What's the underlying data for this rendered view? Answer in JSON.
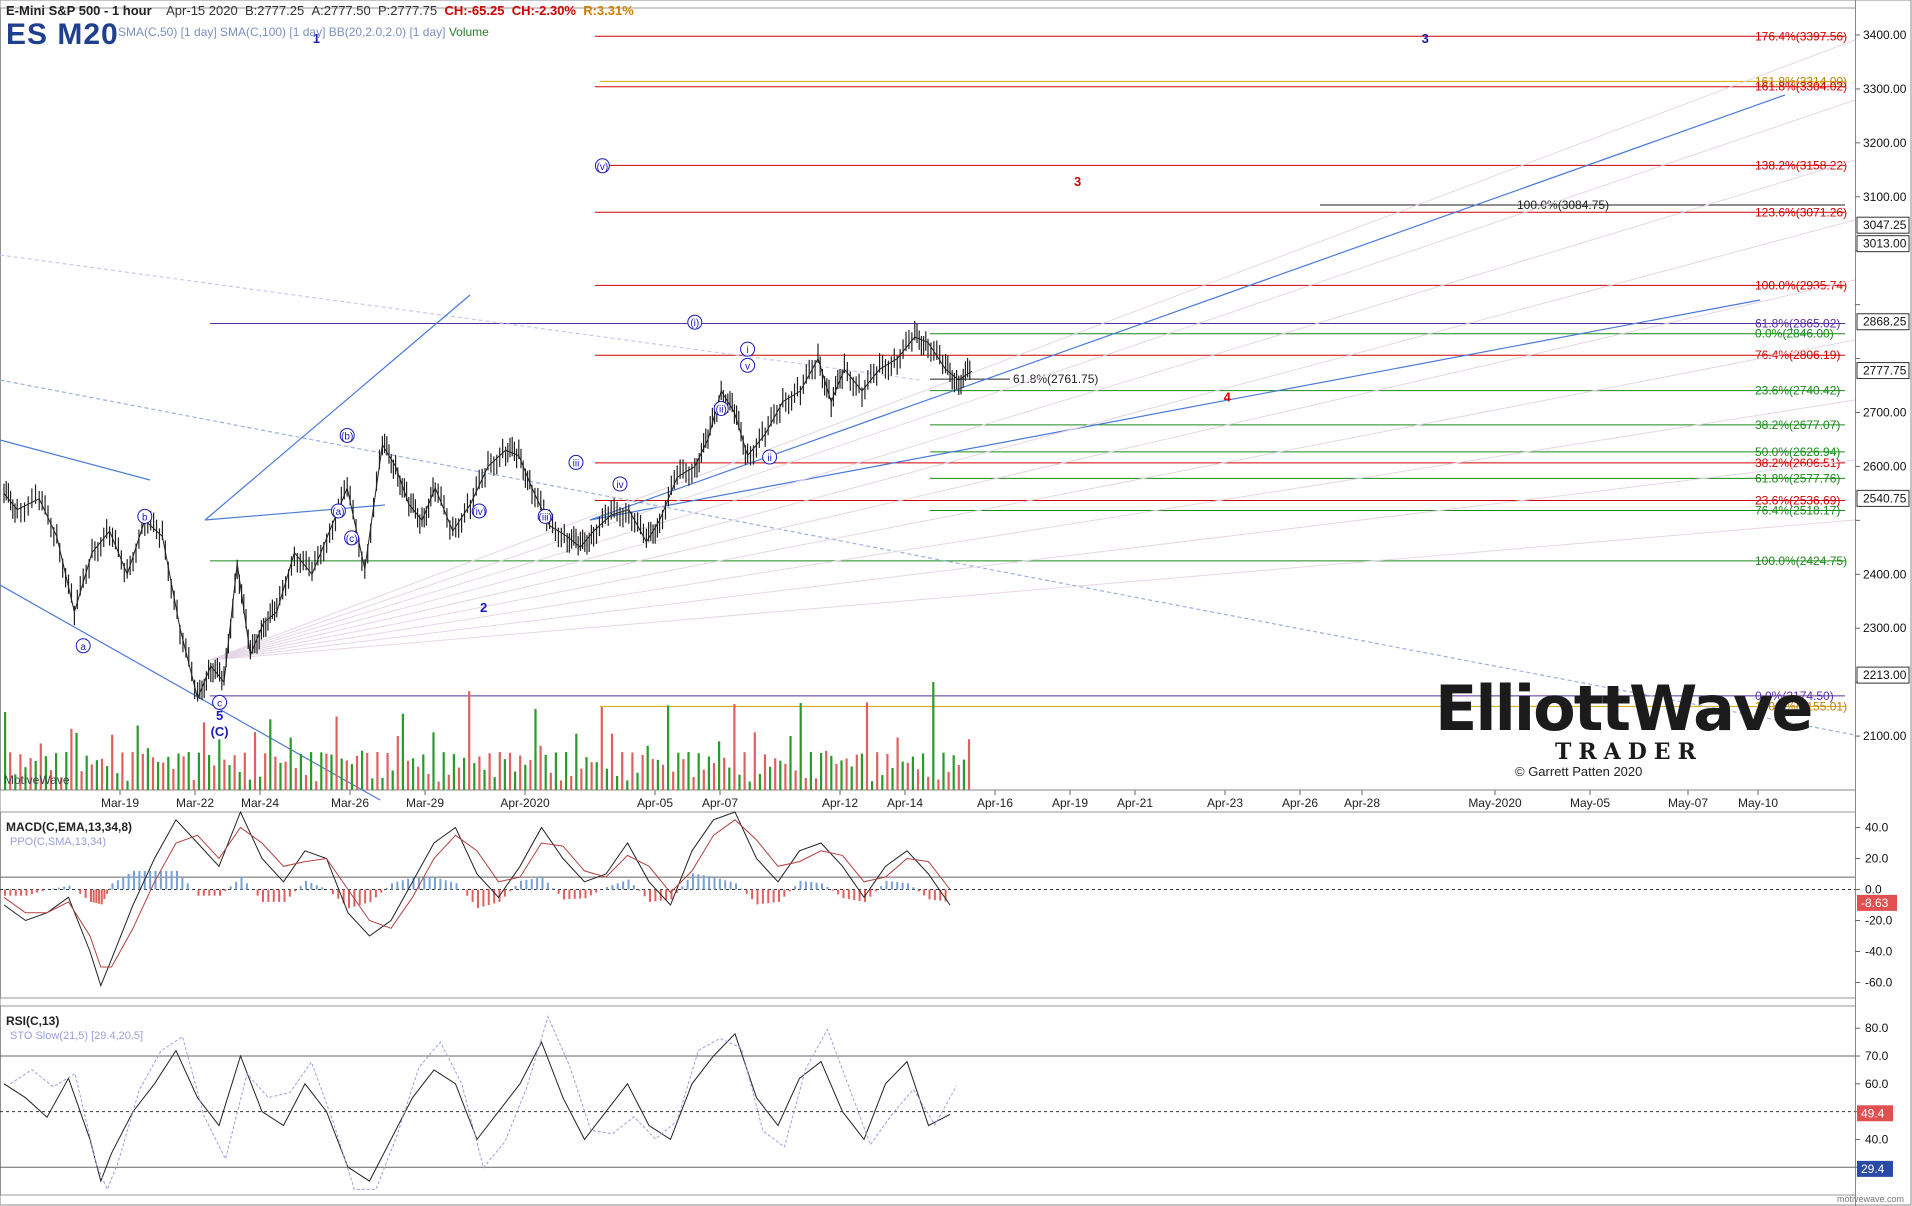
{
  "header": {
    "title": "E-Mini S&P 500 - 1 hour",
    "date": "Apr-15 2020",
    "bid": "B:2777.25",
    "ask": "A:2777.50",
    "price": "P:2777.75",
    "change": "CH:-65.25",
    "change_pct": "CH:-2.30%",
    "range": "R:3.31%",
    "ticker": "ES M20",
    "indicators": "SMA(C,50) [1 day] SMA(C,100) [1 day] BB(20,2.0,2.0) [1 day]",
    "volume_label": "Volume"
  },
  "watermark": "MotiveWave",
  "footer": "motivewave.com",
  "logo": {
    "line1": "ElliottWave",
    "line2": "TRADER",
    "copyright": "© Garrett Patten 2020"
  },
  "colors": {
    "red": "#d00000",
    "blue": "#1a1ab8",
    "green": "#1a8a1a",
    "purple": "#5a2ea0",
    "gold": "#d9a400",
    "up_bar": "#2a9a2a",
    "down_bar": "#e06060"
  },
  "chart_data": [
    {
      "type": "line",
      "name_text": "E-Mini S&P 500 - 1 hour",
      "ylim": [
        2000,
        3450
      ],
      "y_ticks": [
        2100,
        2200,
        2300,
        2400,
        2500,
        2600,
        2700,
        2800,
        2900,
        3000,
        3100,
        3200,
        3300,
        3400
      ],
      "x_ticks": [
        "Mar-19",
        "Mar-22",
        "Mar-24",
        "Mar-26",
        "Mar-29",
        "Apr-2020",
        "Apr-05",
        "Apr-07",
        "Apr-12",
        "Apr-14",
        "Apr-16",
        "Apr-19",
        "Apr-21",
        "Apr-23",
        "Apr-26",
        "Apr-28",
        "May-2020",
        "May-05",
        "May-07",
        "May-10"
      ],
      "price_path": [
        [
          0,
          2550
        ],
        [
          0.3,
          2520
        ],
        [
          0.8,
          2540
        ],
        [
          1.2,
          2470
        ],
        [
          1.6,
          2330
        ],
        [
          2.0,
          2440
        ],
        [
          2.4,
          2480
        ],
        [
          2.8,
          2400
        ],
        [
          3.2,
          2500
        ],
        [
          3.6,
          2470
        ],
        [
          4.0,
          2300
        ],
        [
          4.4,
          2170
        ],
        [
          4.7,
          2230
        ],
        [
          5.0,
          2200
        ],
        [
          5.3,
          2420
        ],
        [
          5.6,
          2250
        ],
        [
          5.9,
          2310
        ],
        [
          6.2,
          2330
        ],
        [
          6.6,
          2440
        ],
        [
          7.0,
          2400
        ],
        [
          7.4,
          2480
        ],
        [
          7.8,
          2560
        ],
        [
          8.2,
          2410
        ],
        [
          8.6,
          2640
        ],
        [
          8.9,
          2600
        ],
        [
          9.2,
          2530
        ],
        [
          9.5,
          2500
        ],
        [
          9.8,
          2560
        ],
        [
          10.2,
          2480
        ],
        [
          10.6,
          2530
        ],
        [
          11.0,
          2600
        ],
        [
          11.4,
          2630
        ],
        [
          11.7,
          2620
        ],
        [
          12.0,
          2560
        ],
        [
          12.4,
          2490
        ],
        [
          12.8,
          2470
        ],
        [
          13.1,
          2450
        ],
        [
          13.4,
          2480
        ],
        [
          13.8,
          2510
        ],
        [
          14.2,
          2520
        ],
        [
          14.6,
          2460
        ],
        [
          14.9,
          2500
        ],
        [
          15.3,
          2580
        ],
        [
          15.7,
          2600
        ],
        [
          16.0,
          2650
        ],
        [
          16.3,
          2740
        ],
        [
          16.6,
          2700
        ],
        [
          16.9,
          2620
        ],
        [
          17.3,
          2660
        ],
        [
          17.7,
          2720
        ],
        [
          18.1,
          2740
        ],
        [
          18.5,
          2800
        ],
        [
          18.8,
          2720
        ],
        [
          19.1,
          2780
        ],
        [
          19.5,
          2740
        ],
        [
          19.9,
          2780
        ],
        [
          20.3,
          2800
        ],
        [
          20.7,
          2840
        ],
        [
          21.0,
          2830
        ],
        [
          21.4,
          2780
        ],
        [
          21.7,
          2760
        ],
        [
          22.0,
          2777
        ]
      ],
      "price_labels": [
        {
          "value": 3400.0,
          "text": "3400.00"
        },
        {
          "value": 3300.0,
          "text": "3300.00"
        },
        {
          "value": 3200.0,
          "text": "3200.00"
        },
        {
          "value": 3100.0,
          "text": "3100.00"
        },
        {
          "value": 3047.25,
          "text": "3047.25"
        },
        {
          "value": 3013.0,
          "text": "3013.00"
        },
        {
          "value": 2868.25,
          "text": "2868.25"
        },
        {
          "value": 2777.75,
          "text": "2777.75"
        },
        {
          "value": 2700.0,
          "text": "2700.00"
        },
        {
          "value": 2600.0,
          "text": "2600.00"
        },
        {
          "value": 2540.75,
          "text": "2540.75"
        },
        {
          "value": 2400.0,
          "text": "2400.00"
        },
        {
          "value": 2300.0,
          "text": "2300.00"
        },
        {
          "value": 2213.0,
          "text": "2213.00"
        },
        {
          "value": 2100.0,
          "text": "2100.00"
        }
      ],
      "fib_levels": [
        {
          "value": 3397.56,
          "text": "176.4%(3397.56)",
          "color": "red"
        },
        {
          "value": 3314.0,
          "text": "161.8%(3314.00)",
          "color": "gold"
        },
        {
          "value": 3304.02,
          "text": "161.8%(3304.02)",
          "color": "red"
        },
        {
          "value": 3158.22,
          "text": "138.2%(3158.22)",
          "color": "red"
        },
        {
          "value": 3084.75,
          "text": "100.0%(3084.75)",
          "color": "black"
        },
        {
          "value": 3071.26,
          "text": "123.6%(3071.26)",
          "color": "red"
        },
        {
          "value": 2935.74,
          "text": "100.0%(2935.74)",
          "color": "red"
        },
        {
          "value": 2865.02,
          "text": "61.8%(2865.02)",
          "color": "purple"
        },
        {
          "value": 2846.0,
          "text": "0.0%(2846.00)",
          "color": "green"
        },
        {
          "value": 2806.19,
          "text": "76.4%(2806.19)",
          "color": "red"
        },
        {
          "value": 2761.75,
          "text": "61.8%(2761.75)",
          "color": "black"
        },
        {
          "value": 2740.42,
          "text": "23.6%(2740.42)",
          "color": "green"
        },
        {
          "value": 2677.07,
          "text": "38.2%(2677.07)",
          "color": "green"
        },
        {
          "value": 2626.94,
          "text": "50.0%(2626.94)",
          "color": "green"
        },
        {
          "value": 2606.51,
          "text": "38.2%(2606.51)",
          "color": "red"
        },
        {
          "value": 2577.76,
          "text": "61.8%(2577.76)",
          "color": "green"
        },
        {
          "value": 2536.69,
          "text": "23.6%(2536.69)",
          "color": "red"
        },
        {
          "value": 2518.17,
          "text": "76.4%(2518.17)",
          "color": "green"
        },
        {
          "value": 2424.75,
          "text": "100.0%(2424.75)",
          "color": "green"
        },
        {
          "value": 2174.5,
          "text": "0.0%(2174.50)",
          "color": "purple"
        },
        {
          "value": 2155.01,
          "text": "100.0%(2155.01)",
          "color": "gold"
        }
      ],
      "wave_labels": [
        "1",
        "2",
        "3",
        "4",
        "5",
        "(C)",
        "a",
        "b",
        "c",
        "i",
        "ii",
        "iii",
        "iv",
        "v",
        "(i)",
        "(ii)",
        "(iii)",
        "(iv)",
        "(v)",
        "(a)",
        "(b)",
        "(c)"
      ]
    },
    {
      "type": "line",
      "title": "MACD(C,EMA,13,34,8)",
      "subtitle": "PPO(C,SMA,13,34)",
      "ylim": [
        -70,
        50
      ],
      "y_ticks": [
        40.0,
        20.0,
        0.0,
        -20.0,
        -40.0,
        -60.0
      ],
      "current": "-8.63",
      "macd": [
        [
          0,
          -10
        ],
        [
          1,
          -20
        ],
        [
          2,
          -15
        ],
        [
          3,
          -5
        ],
        [
          4,
          -40
        ],
        [
          4.5,
          -62
        ],
        [
          5,
          -45
        ],
        [
          6,
          -10
        ],
        [
          7,
          20
        ],
        [
          8,
          45
        ],
        [
          9,
          30
        ],
        [
          10,
          15
        ],
        [
          11,
          50
        ],
        [
          12,
          20
        ],
        [
          13,
          5
        ],
        [
          14,
          25
        ],
        [
          15,
          20
        ],
        [
          16,
          -15
        ],
        [
          17,
          -30
        ],
        [
          18,
          -20
        ],
        [
          19,
          5
        ],
        [
          20,
          30
        ],
        [
          21,
          40
        ],
        [
          22,
          10
        ],
        [
          23,
          -5
        ],
        [
          24,
          15
        ],
        [
          25,
          40
        ],
        [
          26,
          20
        ],
        [
          27,
          5
        ],
        [
          28,
          10
        ],
        [
          29,
          30
        ],
        [
          30,
          5
        ],
        [
          31,
          -10
        ],
        [
          32,
          25
        ],
        [
          33,
          45
        ],
        [
          34,
          50
        ],
        [
          35,
          20
        ],
        [
          36,
          5
        ],
        [
          37,
          25
        ],
        [
          38,
          30
        ],
        [
          39,
          15
        ],
        [
          40,
          -5
        ],
        [
          41,
          15
        ],
        [
          42,
          25
        ],
        [
          43,
          10
        ],
        [
          44,
          -10
        ]
      ],
      "signal": [
        [
          0,
          -5
        ],
        [
          1,
          -15
        ],
        [
          2,
          -15
        ],
        [
          3,
          -8
        ],
        [
          4,
          -30
        ],
        [
          4.5,
          -50
        ],
        [
          5,
          -50
        ],
        [
          6,
          -25
        ],
        [
          7,
          5
        ],
        [
          8,
          30
        ],
        [
          9,
          35
        ],
        [
          10,
          20
        ],
        [
          11,
          40
        ],
        [
          12,
          30
        ],
        [
          13,
          15
        ],
        [
          14,
          18
        ],
        [
          15,
          20
        ],
        [
          16,
          0
        ],
        [
          17,
          -20
        ],
        [
          18,
          -25
        ],
        [
          19,
          -5
        ],
        [
          20,
          20
        ],
        [
          21,
          35
        ],
        [
          22,
          25
        ],
        [
          23,
          5
        ],
        [
          24,
          8
        ],
        [
          25,
          30
        ],
        [
          26,
          28
        ],
        [
          27,
          12
        ],
        [
          28,
          8
        ],
        [
          29,
          22
        ],
        [
          30,
          15
        ],
        [
          31,
          -2
        ],
        [
          32,
          12
        ],
        [
          33,
          35
        ],
        [
          34,
          45
        ],
        [
          35,
          32
        ],
        [
          36,
          15
        ],
        [
          37,
          18
        ],
        [
          38,
          25
        ],
        [
          39,
          22
        ],
        [
          40,
          5
        ],
        [
          41,
          8
        ],
        [
          42,
          20
        ],
        [
          43,
          18
        ],
        [
          44,
          0
        ]
      ]
    },
    {
      "type": "line",
      "title": "RSI(C,13)",
      "subtitle": "STO Slow(21,5) [29.4,20.5]",
      "ylim": [
        20,
        88
      ],
      "y_ticks": [
        80.0,
        70.0,
        60.0,
        50.0,
        40.0,
        30.0
      ],
      "current_rsi": "49.4",
      "current_sto": "29.4",
      "rsi": [
        [
          0,
          60
        ],
        [
          1,
          55
        ],
        [
          2,
          48
        ],
        [
          3,
          62
        ],
        [
          4,
          40
        ],
        [
          4.5,
          25
        ],
        [
          5,
          35
        ],
        [
          6,
          50
        ],
        [
          7,
          60
        ],
        [
          8,
          72
        ],
        [
          9,
          55
        ],
        [
          10,
          45
        ],
        [
          11,
          70
        ],
        [
          12,
          50
        ],
        [
          13,
          45
        ],
        [
          14,
          60
        ],
        [
          15,
          50
        ],
        [
          16,
          30
        ],
        [
          17,
          25
        ],
        [
          18,
          40
        ],
        [
          19,
          55
        ],
        [
          20,
          65
        ],
        [
          21,
          60
        ],
        [
          22,
          40
        ],
        [
          23,
          50
        ],
        [
          24,
          60
        ],
        [
          25,
          75
        ],
        [
          26,
          55
        ],
        [
          27,
          40
        ],
        [
          28,
          50
        ],
        [
          29,
          60
        ],
        [
          30,
          45
        ],
        [
          31,
          40
        ],
        [
          32,
          60
        ],
        [
          33,
          70
        ],
        [
          34,
          78
        ],
        [
          35,
          55
        ],
        [
          36,
          45
        ],
        [
          37,
          62
        ],
        [
          38,
          68
        ],
        [
          39,
          50
        ],
        [
          40,
          40
        ],
        [
          41,
          60
        ],
        [
          42,
          68
        ],
        [
          43,
          45
        ],
        [
          44,
          49
        ]
      ]
    }
  ]
}
